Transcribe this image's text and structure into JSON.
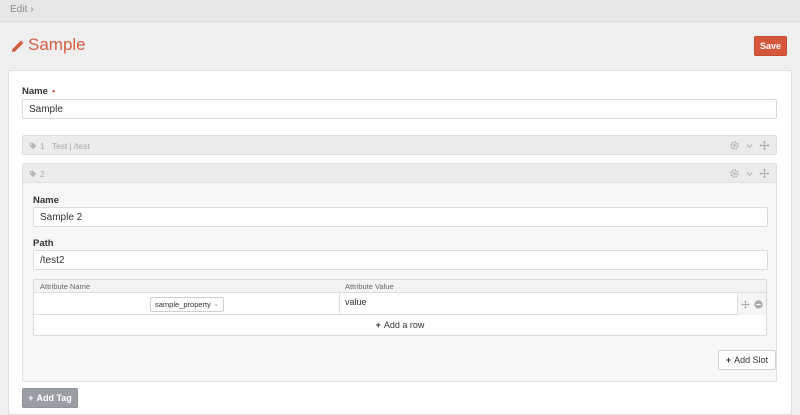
{
  "breadcrumb": {
    "item": "Edit",
    "separator": "›"
  },
  "page": {
    "title": "Sample",
    "save_label": "Save"
  },
  "form": {
    "name_label": "Name",
    "required_mark": "•",
    "name_value": "Sample"
  },
  "tags": [
    {
      "number": "1",
      "name": "Test",
      "separator": "|",
      "path": "/test",
      "expanded": false
    },
    {
      "number": "2",
      "expanded": true,
      "name_label": "Name",
      "name_value": "Sample 2",
      "path_label": "Path",
      "path_value": "/test2",
      "attributes": {
        "header_name": "Attribute Name",
        "header_value": "Attribute Value",
        "rows": [
          {
            "name": "sample_property",
            "value": "value"
          }
        ],
        "add_row_label": "Add a row"
      },
      "add_slot_label": "Add Slot"
    }
  ],
  "add_tag_label": "Add Tag",
  "icons": {
    "title": "pencil-icon",
    "tag": "tag-icon",
    "settings": "gear-icon",
    "move": "move-icon",
    "remove": "minus-circle-icon",
    "add": "plus-icon",
    "dropdown": "chevron-down-icon"
  },
  "colors": {
    "accent": "#d65f42",
    "save_button": "#d6573b",
    "add_tag_button": "#999ea4",
    "page_background": "#efefef"
  }
}
